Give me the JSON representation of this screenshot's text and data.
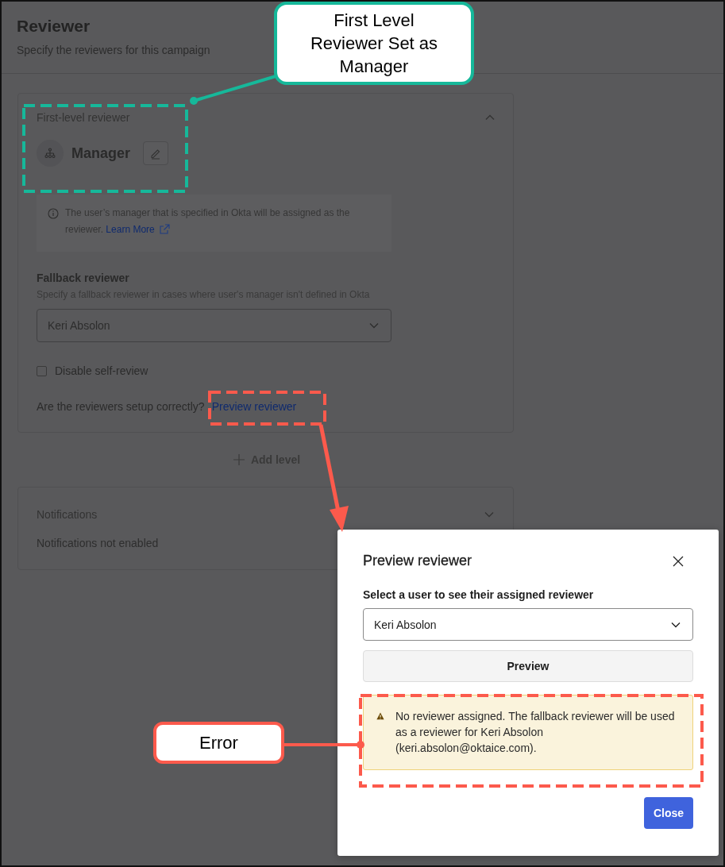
{
  "page": {
    "title": "Reviewer",
    "subtitle": "Specify the reviewers for this campaign"
  },
  "reviewer_card": {
    "heading": "First-level reviewer",
    "expanded": true,
    "reviewer": "Manager",
    "info": "The user’s manager that is specified in Okta will be assigned as the reviewer.",
    "info_link": "Learn More",
    "fallback": {
      "label": "Fallback reviewer",
      "hint": "Specify a fallback reviewer in cases where user's manager isn't defined in Okta",
      "value": "Keri Absolon"
    },
    "disable_self_review": {
      "label": "Disable self-review",
      "checked": false
    },
    "question": "Are the reviewers setup correctly?",
    "preview_link": "Preview reviewer"
  },
  "add_level": "Add level",
  "notifications": {
    "heading": "Notifications",
    "expanded": false,
    "status": "Notifications not enabled"
  },
  "dialog": {
    "title": "Preview reviewer",
    "field_label": "Select a user to see their assigned reviewer",
    "value": "Keri Absolon",
    "preview_button": "Preview",
    "alert": {
      "kind": "warning",
      "text": "No reviewer assigned. The fallback reviewer will be used as a reviewer for Keri Absolon (keri.absolon@oktaice.com)."
    },
    "close_button": "Close"
  },
  "annotations": [
    {
      "text": "First Level Reviewer Set as Manager",
      "color": "#16b89a"
    },
    {
      "text": "Error",
      "color": "#fc5a4c"
    }
  ]
}
